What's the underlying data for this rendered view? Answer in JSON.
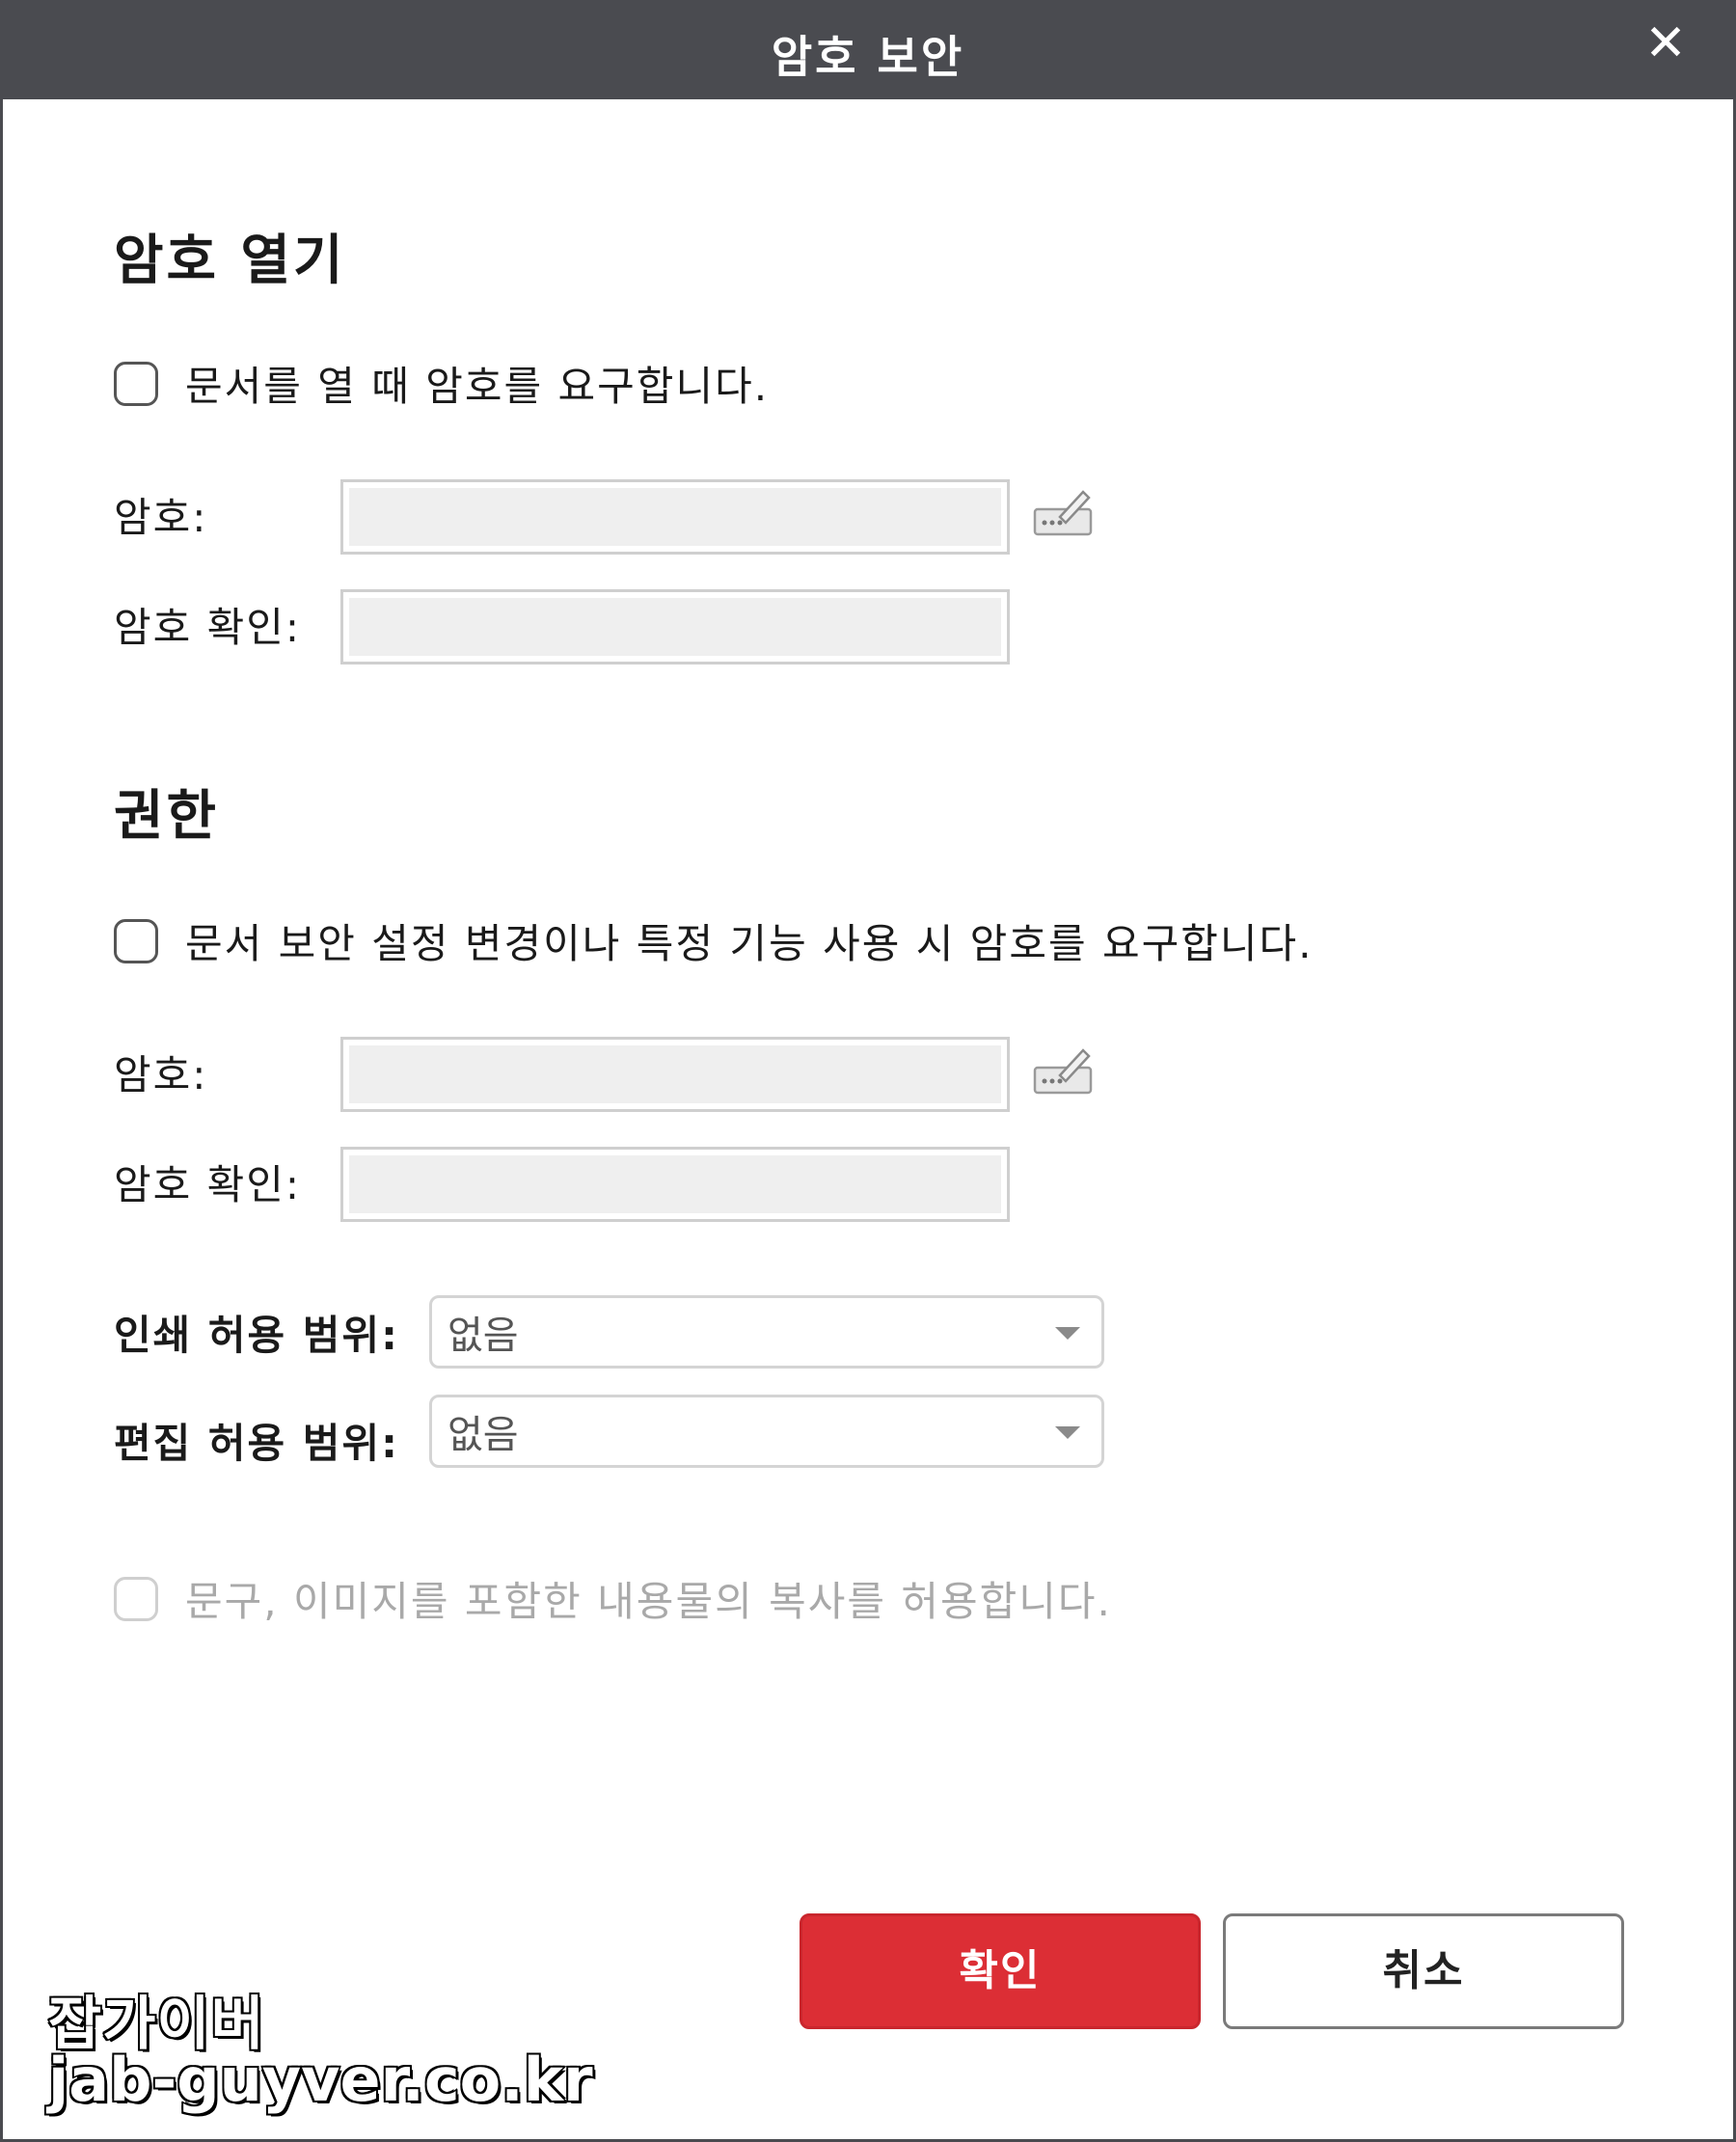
{
  "window": {
    "title": "암호 보안",
    "close_icon": "close-icon"
  },
  "open_password": {
    "section_title": "암호 열기",
    "require_checkbox_label": "문서를 열 때 암호를 요구합니다.",
    "require_checked": false,
    "password_label": "암호:",
    "confirm_label": "암호 확인:",
    "password_value": "",
    "confirm_value": ""
  },
  "permissions": {
    "section_title": "권한",
    "require_checkbox_label": "문서 보안 설정 변경이나 특정 기능 사용 시 암호를 요구합니다.",
    "require_checked": false,
    "password_label": "암호:",
    "confirm_label": "암호 확인:",
    "password_value": "",
    "confirm_value": "",
    "print_label": "인쇄 허용 범위:",
    "print_value": "없음",
    "edit_label": "편집 허용 범위:",
    "edit_value": "없음",
    "copy_checkbox_label": "문구, 이미지를 포함한 내용물의 복사를 허용합니다.",
    "copy_checked": false,
    "copy_disabled": true
  },
  "buttons": {
    "ok_label": "확인",
    "cancel_label": "취소"
  },
  "watermark": {
    "line1": "잡가이버",
    "line2": "jab-guyver.co.kr"
  },
  "colors": {
    "titlebar": "#4a4b50",
    "primary_button": "#dc2e35",
    "input_fill": "#efefef"
  }
}
